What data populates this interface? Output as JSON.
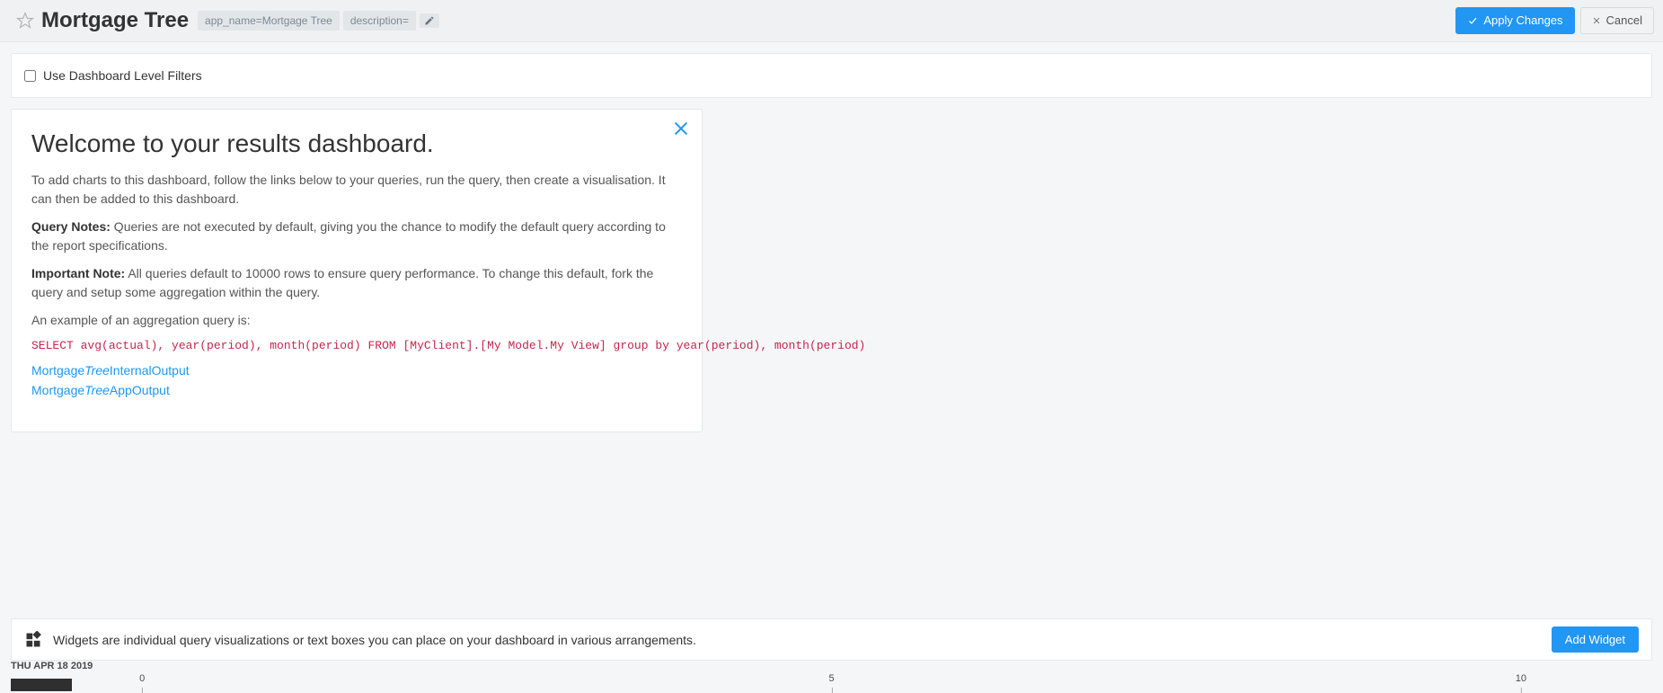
{
  "header": {
    "title": "Mortgage Tree",
    "tag_app_name": "app_name=Mortgage Tree",
    "tag_description": "description=",
    "apply_label": "Apply Changes",
    "cancel_label": "Cancel"
  },
  "filters": {
    "checkbox_label": "Use Dashboard Level Filters"
  },
  "welcome": {
    "heading": "Welcome to your results dashboard.",
    "intro": "To add charts to this dashboard, follow the links below to your queries, run the query, then create a visualisation. It can then be added to this dashboard.",
    "query_notes_label": "Query Notes:",
    "query_notes_body": " Queries are not executed by default, giving you the chance to modify the default query according to the report specifications.",
    "important_label": "Important Note:",
    "important_body": " All queries default to 10000 rows to ensure query performance. To change this default, fork the query and setup some aggregation within the query.",
    "aggregation_intro": "An example of an aggregation query is:",
    "sql": "SELECT avg(actual), year(period), month(period) FROM [MyClient].[My Model.My View] group by year(period), month(period)",
    "links": [
      {
        "prefix": "Mortgage",
        "italic": "Tree",
        "suffix": "InternalOutput"
      },
      {
        "prefix": "Mortgage",
        "italic": "Tree",
        "suffix": "AppOutput"
      }
    ]
  },
  "bottom": {
    "description": "Widgets are individual query visualizations or text boxes you can place on your dashboard in various arrangements.",
    "add_label": "Add Widget"
  },
  "axis": {
    "date_label": "THU APR 18 2019",
    "ticks": [
      "0",
      "5",
      "10"
    ]
  }
}
